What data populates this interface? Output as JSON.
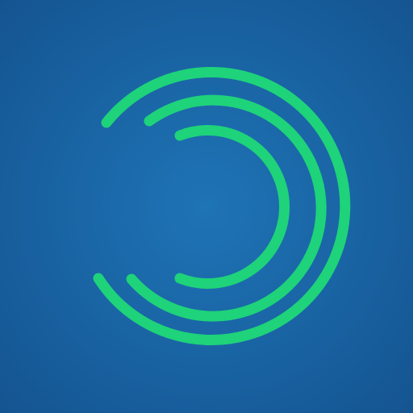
{
  "icon": {
    "name": "concentric-arcs-logo",
    "colors": {
      "background_center": "#1e74b6",
      "background_edge": "#14528f",
      "arc_stroke": "#1ed37a"
    },
    "arc_count": 3
  }
}
